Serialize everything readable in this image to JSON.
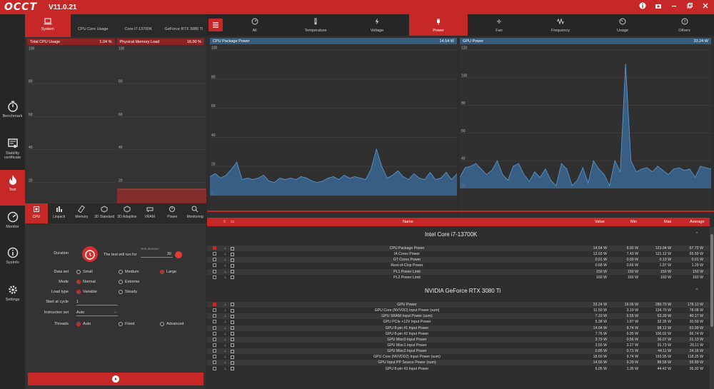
{
  "app": {
    "logo": "OCCT",
    "version": "V11.0.21"
  },
  "titlebar_icons": [
    "info-icon",
    "camera-icon",
    "minimize-icon",
    "restore-icon",
    "close-icon"
  ],
  "nav": [
    {
      "label": "Benchmark",
      "icon": "stopwatch-icon"
    },
    {
      "label": "Stability certificate",
      "icon": "certificate-icon"
    },
    {
      "label": "Test",
      "icon": "flame-icon",
      "active": true
    },
    {
      "label": "Monitor",
      "icon": "gauge-icon"
    },
    {
      "label": "SysInfo",
      "icon": "info-icon"
    },
    {
      "label": "Settings",
      "icon": "gear-icon"
    }
  ],
  "top_tabs": [
    "System",
    "CPU Core Usage",
    "Core i7-13700K",
    "GeForce RTX 3080 Ti"
  ],
  "metrics": [
    {
      "title": "Total CPU Usage",
      "value": "1.04 %",
      "ticks": [
        "100",
        "80",
        "60",
        "40",
        "20",
        "0"
      ],
      "data": [
        1,
        1,
        1,
        1,
        2,
        3,
        1,
        1,
        5,
        1,
        2,
        1,
        1,
        2,
        1,
        1,
        1,
        1,
        2,
        1,
        1,
        1,
        1,
        1,
        1,
        1,
        1,
        2,
        1,
        1,
        1,
        1,
        1,
        1,
        6,
        2,
        1,
        1,
        1,
        2,
        1,
        1,
        1,
        1,
        3,
        1,
        1,
        1
      ]
    },
    {
      "title": "Physical Memory Load",
      "value": "16.00 %",
      "ticks": [
        "100",
        "80",
        "60",
        "40",
        "20",
        "0"
      ],
      "data": [
        16,
        16,
        16,
        16,
        16,
        16,
        16,
        16,
        16,
        16,
        16,
        16,
        16,
        16,
        16,
        16,
        16,
        16,
        16,
        16,
        16,
        16,
        16,
        16,
        16,
        16,
        16,
        16,
        16,
        16,
        16,
        16,
        16,
        16,
        16,
        16,
        16,
        16,
        16,
        16,
        16,
        16,
        16,
        16,
        16,
        16,
        16,
        16
      ]
    }
  ],
  "test_tabs": [
    "CPU",
    "Linpack",
    "Memory",
    "3D Standard",
    "3D Adaptive",
    "VRAM",
    "Power",
    "Monitoring"
  ],
  "settings": {
    "duration_label": "Duration",
    "duration_note": "The test will run for",
    "test_duration_caption": "Test duration",
    "duration_value": "30",
    "dataset_label": "Data set",
    "dataset_options": [
      "Small",
      "Medium",
      "Large"
    ],
    "mode_label": "Mode",
    "mode_options": [
      "Normal",
      "Extreme"
    ],
    "load_label": "Load type",
    "load_options": [
      "Variable",
      "Steady"
    ],
    "start_label": "Start at cycle",
    "start_value": "1",
    "instr_label": "Instruction set",
    "instr_value": "Auto",
    "threads_label": "Threads",
    "threads_options": [
      "Auto",
      "Fixed",
      "Advanced"
    ]
  },
  "categories": [
    "All",
    "Temperature",
    "Voltage",
    "Power",
    "Fan",
    "Frequency",
    "Usage",
    "Others"
  ],
  "charts": [
    {
      "title": "CPU Package Power",
      "value": "14.54 W",
      "ticks": [
        "100",
        "80",
        "60",
        "40",
        "20",
        "0"
      ],
      "data": [
        13,
        15,
        12,
        14,
        18,
        23,
        11,
        12,
        11,
        12,
        14,
        10,
        9,
        12,
        11,
        12,
        11,
        13,
        12,
        10,
        9,
        10,
        12,
        13,
        11,
        14,
        12,
        13,
        12,
        11,
        18,
        32,
        20,
        12,
        14,
        17,
        13,
        11,
        15,
        12,
        11,
        16,
        11,
        12,
        16,
        11,
        15
      ]
    },
    {
      "title": "GPU Power",
      "value": "33.24 W",
      "ticks": [
        "120",
        "100",
        "80",
        "60",
        "40",
        "20"
      ],
      "data": [
        28,
        35,
        36,
        38,
        34,
        30,
        33,
        40,
        30,
        26,
        36,
        38,
        30,
        25,
        32,
        28,
        34,
        26,
        22,
        38,
        34,
        22,
        26,
        35,
        24,
        40,
        34,
        30,
        22,
        40,
        32,
        110,
        40,
        32,
        34,
        35,
        32,
        36,
        33,
        30,
        34,
        35,
        33,
        34,
        28,
        36,
        35,
        34
      ]
    }
  ],
  "table": {
    "headers": {
      "name": "Name",
      "value": "Value",
      "min": "Min",
      "max": "Max",
      "avg": "Average"
    },
    "groups": [
      {
        "title": "Intel Core i7-13700K",
        "rows": [
          {
            "name": "CPU Package Power",
            "value": "14.54 W",
            "min": "8.92 W",
            "max": "123.94 W",
            "avg": "67.72 W",
            "checked": true
          },
          {
            "name": "IA Cores Power",
            "value": "13.03 W",
            "min": "7.43 W",
            "max": "121.12 W",
            "avg": "65.59 W",
            "checked": false
          },
          {
            "name": "GT Cores Power",
            "value": "0.01 W",
            "min": "0.00 W",
            "max": "0.13 W",
            "avg": "0.01 W",
            "checked": false
          },
          {
            "name": "Rest-of-Chip Power",
            "value": "0.68 W",
            "min": "0.66 W",
            "max": "1.97 W",
            "avg": "1.29 W",
            "checked": false
          },
          {
            "name": "PL1 Power Limit",
            "value": "150 W",
            "min": "150 W",
            "max": "150 W",
            "avg": "150 W",
            "checked": false
          },
          {
            "name": "PL2 Power Limit",
            "value": "160 W",
            "min": "160 W",
            "max": "160 W",
            "avg": "160 W",
            "checked": false
          }
        ]
      },
      {
        "title": "NVIDIA GeForce RTX 3080 Ti",
        "rows": [
          {
            "name": "GPU Power",
            "value": "33.24 W",
            "min": "19.06 W",
            "max": "280.70 W",
            "avg": "178.13 W",
            "checked": true
          },
          {
            "name": "GPU Core (NVVDD) Input Power (sum)",
            "value": "11.59 W",
            "min": "3.19 W",
            "max": "134.70 W",
            "avg": "78.08 W",
            "checked": false
          },
          {
            "name": "GPU SRAM Input Power (sum)",
            "value": "7.10 W",
            "min": "6.55 W",
            "max": "63.39 W",
            "avg": "40.17 W",
            "checked": false
          },
          {
            "name": "GPU PCIe +12V Input Power",
            "value": "5.38 W",
            "min": "1.87 W",
            "max": "32.35 W",
            "avg": "20.59 W",
            "checked": false
          },
          {
            "name": "GPU 8-pin #1 Input Power",
            "value": "14.04 W",
            "min": "8.74 W",
            "max": "98.12 W",
            "avg": "63.99 W",
            "checked": false
          },
          {
            "name": "GPU 8-pin #2 Input Power",
            "value": "7.76 W",
            "min": "6.95 W",
            "max": "106.02 W",
            "avg": "66.74 W",
            "checked": false
          },
          {
            "name": "GPU Misc0 Input Power",
            "value": "3.79 W",
            "min": "0.56 W",
            "max": "36.07 W",
            "avg": "21.13 W",
            "checked": false
          },
          {
            "name": "GPU Misc1 Input Power",
            "value": "3.55 W",
            "min": "3.27 W",
            "max": "31.73 W",
            "avg": "20.11 W",
            "checked": false
          },
          {
            "name": "GPU Misc2 Input Power",
            "value": "0.85 W",
            "min": "0.71 W",
            "max": "44.11 W",
            "avg": "24.16 W",
            "checked": false
          },
          {
            "name": "GPU Core (NVVDD2) Input Power (sum)",
            "value": "18.69 W",
            "min": "9.74 W",
            "max": "193.95 W",
            "avg": "118.25 W",
            "checked": false
          },
          {
            "name": "GPU Input PP Source Power (sum)",
            "value": "14.55 W",
            "min": "9.29 W",
            "max": "88.58 W",
            "avg": "59.89 W",
            "checked": false
          },
          {
            "name": "GPU 8-pin #3 Input Power",
            "value": "6.05 W",
            "min": "1.35 W",
            "max": "44.42 W",
            "avg": "26.92 W",
            "checked": false
          }
        ]
      }
    ]
  }
}
